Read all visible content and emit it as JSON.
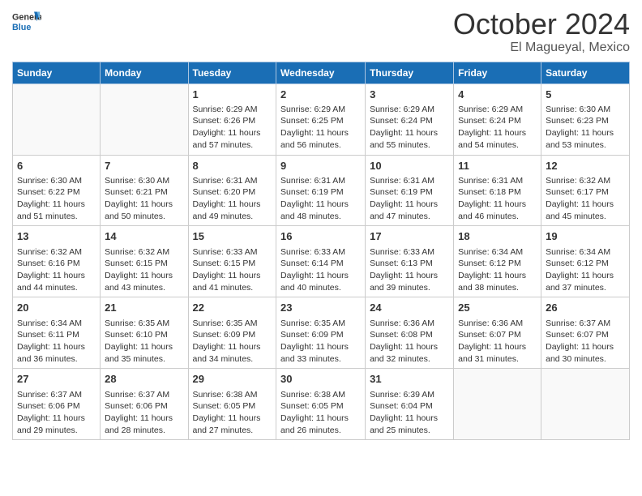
{
  "header": {
    "logo_general": "General",
    "logo_blue": "Blue",
    "month": "October 2024",
    "location": "El Magueyal, Mexico"
  },
  "days_of_week": [
    "Sunday",
    "Monday",
    "Tuesday",
    "Wednesday",
    "Thursday",
    "Friday",
    "Saturday"
  ],
  "weeks": [
    [
      {
        "day": "",
        "content": ""
      },
      {
        "day": "",
        "content": ""
      },
      {
        "day": "1",
        "content": "Sunrise: 6:29 AM\nSunset: 6:26 PM\nDaylight: 11 hours and 57 minutes."
      },
      {
        "day": "2",
        "content": "Sunrise: 6:29 AM\nSunset: 6:25 PM\nDaylight: 11 hours and 56 minutes."
      },
      {
        "day": "3",
        "content": "Sunrise: 6:29 AM\nSunset: 6:24 PM\nDaylight: 11 hours and 55 minutes."
      },
      {
        "day": "4",
        "content": "Sunrise: 6:29 AM\nSunset: 6:24 PM\nDaylight: 11 hours and 54 minutes."
      },
      {
        "day": "5",
        "content": "Sunrise: 6:30 AM\nSunset: 6:23 PM\nDaylight: 11 hours and 53 minutes."
      }
    ],
    [
      {
        "day": "6",
        "content": "Sunrise: 6:30 AM\nSunset: 6:22 PM\nDaylight: 11 hours and 51 minutes."
      },
      {
        "day": "7",
        "content": "Sunrise: 6:30 AM\nSunset: 6:21 PM\nDaylight: 11 hours and 50 minutes."
      },
      {
        "day": "8",
        "content": "Sunrise: 6:31 AM\nSunset: 6:20 PM\nDaylight: 11 hours and 49 minutes."
      },
      {
        "day": "9",
        "content": "Sunrise: 6:31 AM\nSunset: 6:19 PM\nDaylight: 11 hours and 48 minutes."
      },
      {
        "day": "10",
        "content": "Sunrise: 6:31 AM\nSunset: 6:19 PM\nDaylight: 11 hours and 47 minutes."
      },
      {
        "day": "11",
        "content": "Sunrise: 6:31 AM\nSunset: 6:18 PM\nDaylight: 11 hours and 46 minutes."
      },
      {
        "day": "12",
        "content": "Sunrise: 6:32 AM\nSunset: 6:17 PM\nDaylight: 11 hours and 45 minutes."
      }
    ],
    [
      {
        "day": "13",
        "content": "Sunrise: 6:32 AM\nSunset: 6:16 PM\nDaylight: 11 hours and 44 minutes."
      },
      {
        "day": "14",
        "content": "Sunrise: 6:32 AM\nSunset: 6:15 PM\nDaylight: 11 hours and 43 minutes."
      },
      {
        "day": "15",
        "content": "Sunrise: 6:33 AM\nSunset: 6:15 PM\nDaylight: 11 hours and 41 minutes."
      },
      {
        "day": "16",
        "content": "Sunrise: 6:33 AM\nSunset: 6:14 PM\nDaylight: 11 hours and 40 minutes."
      },
      {
        "day": "17",
        "content": "Sunrise: 6:33 AM\nSunset: 6:13 PM\nDaylight: 11 hours and 39 minutes."
      },
      {
        "day": "18",
        "content": "Sunrise: 6:34 AM\nSunset: 6:12 PM\nDaylight: 11 hours and 38 minutes."
      },
      {
        "day": "19",
        "content": "Sunrise: 6:34 AM\nSunset: 6:12 PM\nDaylight: 11 hours and 37 minutes."
      }
    ],
    [
      {
        "day": "20",
        "content": "Sunrise: 6:34 AM\nSunset: 6:11 PM\nDaylight: 11 hours and 36 minutes."
      },
      {
        "day": "21",
        "content": "Sunrise: 6:35 AM\nSunset: 6:10 PM\nDaylight: 11 hours and 35 minutes."
      },
      {
        "day": "22",
        "content": "Sunrise: 6:35 AM\nSunset: 6:09 PM\nDaylight: 11 hours and 34 minutes."
      },
      {
        "day": "23",
        "content": "Sunrise: 6:35 AM\nSunset: 6:09 PM\nDaylight: 11 hours and 33 minutes."
      },
      {
        "day": "24",
        "content": "Sunrise: 6:36 AM\nSunset: 6:08 PM\nDaylight: 11 hours and 32 minutes."
      },
      {
        "day": "25",
        "content": "Sunrise: 6:36 AM\nSunset: 6:07 PM\nDaylight: 11 hours and 31 minutes."
      },
      {
        "day": "26",
        "content": "Sunrise: 6:37 AM\nSunset: 6:07 PM\nDaylight: 11 hours and 30 minutes."
      }
    ],
    [
      {
        "day": "27",
        "content": "Sunrise: 6:37 AM\nSunset: 6:06 PM\nDaylight: 11 hours and 29 minutes."
      },
      {
        "day": "28",
        "content": "Sunrise: 6:37 AM\nSunset: 6:06 PM\nDaylight: 11 hours and 28 minutes."
      },
      {
        "day": "29",
        "content": "Sunrise: 6:38 AM\nSunset: 6:05 PM\nDaylight: 11 hours and 27 minutes."
      },
      {
        "day": "30",
        "content": "Sunrise: 6:38 AM\nSunset: 6:05 PM\nDaylight: 11 hours and 26 minutes."
      },
      {
        "day": "31",
        "content": "Sunrise: 6:39 AM\nSunset: 6:04 PM\nDaylight: 11 hours and 25 minutes."
      },
      {
        "day": "",
        "content": ""
      },
      {
        "day": "",
        "content": ""
      }
    ]
  ]
}
